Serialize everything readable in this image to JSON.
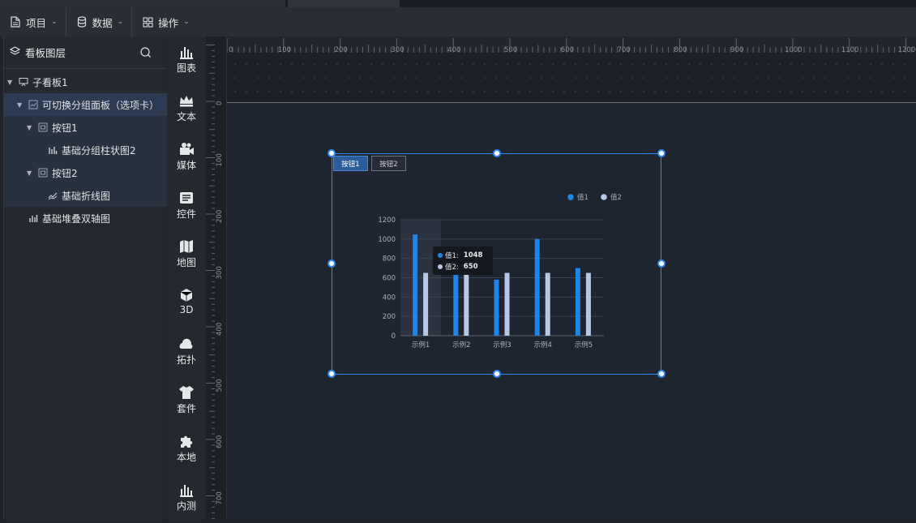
{
  "toolbar": {
    "project_label": "项目",
    "data_label": "数据",
    "ops_label": "操作"
  },
  "layers": {
    "title": "看板图层",
    "items": [
      {
        "label": "子看板1",
        "icon": "monitor-icon"
      },
      {
        "label": "可切换分组面板（选项卡）",
        "icon": "tab-panel-icon"
      },
      {
        "label": "按钮1",
        "icon": "button-icon"
      },
      {
        "label": "基础分组柱状图2",
        "icon": "bar-chart-icon"
      },
      {
        "label": "按钮2",
        "icon": "button-icon"
      },
      {
        "label": "基础折线图",
        "icon": "line-chart-icon"
      },
      {
        "label": "基础堆叠双轴图",
        "icon": "bar-chart-icon"
      }
    ]
  },
  "palette": [
    {
      "label": "图表",
      "icon": "chart-icon"
    },
    {
      "label": "文本",
      "icon": "crown-icon"
    },
    {
      "label": "媒体",
      "icon": "video-icon"
    },
    {
      "label": "控件",
      "icon": "control-icon"
    },
    {
      "label": "地图",
      "icon": "map-icon"
    },
    {
      "label": "3D",
      "icon": "cube-icon"
    },
    {
      "label": "拓扑",
      "icon": "cloud-icon"
    },
    {
      "label": "套件",
      "icon": "shirt-icon"
    },
    {
      "label": "本地",
      "icon": "puzzle-icon"
    },
    {
      "label": "内测",
      "icon": "chart-icon"
    }
  ],
  "rulers": {
    "h_ticks": [
      "0",
      "100",
      "200",
      "300",
      "400",
      "500",
      "600",
      "700",
      "800",
      "900",
      "1000",
      "1100",
      "1200"
    ],
    "v_ticks": [
      "0",
      "100",
      "200",
      "300",
      "400",
      "500",
      "600",
      "700"
    ]
  },
  "tabs": [
    "按钮1",
    "按钮2"
  ],
  "tooltip": {
    "rows": [
      {
        "name": "值1:",
        "value": "1048"
      },
      {
        "name": "值2:",
        "value": "650"
      }
    ]
  },
  "colors": {
    "series1": "#1f86e6",
    "series2": "#b3c9e6",
    "accent": "#2e8cf0"
  },
  "chart_data": {
    "type": "bar",
    "categories": [
      "示例1",
      "示例2",
      "示例3",
      "示例4",
      "示例5"
    ],
    "series": [
      {
        "name": "值1",
        "values": [
          1048,
          735,
          580,
          1000,
          700
        ]
      },
      {
        "name": "值2",
        "values": [
          650,
          650,
          650,
          650,
          650
        ]
      }
    ],
    "ylim": [
      0,
      1200
    ],
    "yticks": [
      "0",
      "200",
      "400",
      "600",
      "800",
      "1000",
      "1200"
    ],
    "grid": true,
    "legend": "top-right"
  }
}
